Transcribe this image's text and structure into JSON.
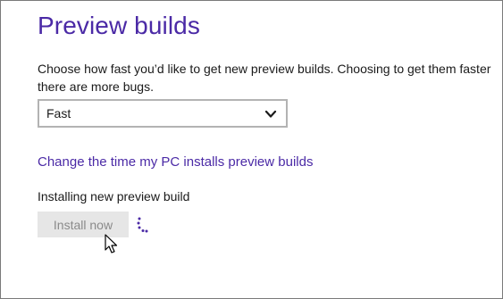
{
  "page": {
    "title": "Preview builds",
    "description_line1": "Choose how fast you’d like to get new preview builds. Choosing to get them faster",
    "description_line2": "there are more bugs."
  },
  "speed_select": {
    "value": "Fast",
    "icon": "chevron-down-icon"
  },
  "links": {
    "change_time": "Change the time my PC installs preview builds"
  },
  "install": {
    "status_text": "Installing new preview build",
    "button_label": "Install now",
    "spinner_icon": "progress-ring-icon"
  },
  "colors": {
    "accent": "#4b2aa6",
    "button_disabled_bg": "#e6e6e6",
    "button_disabled_text": "#8a8a8a"
  }
}
